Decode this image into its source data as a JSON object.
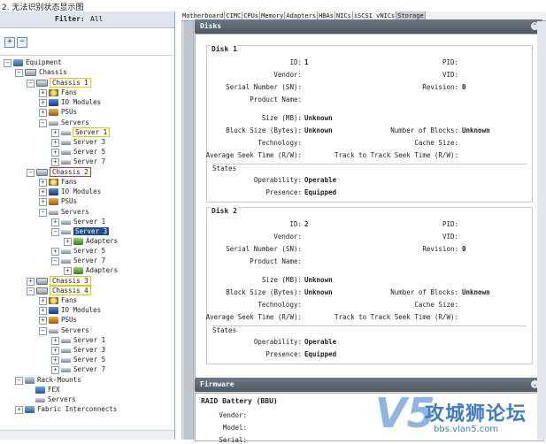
{
  "caption": "2. 无法识别状态显示图",
  "filter": {
    "label": "Filter:",
    "value": "All"
  },
  "toolbar": {
    "expand": "+",
    "collapse": "−"
  },
  "tree": {
    "equipment": "Equipment",
    "chassis": "Chassis",
    "c1": "Chassis 1",
    "fans": "Fans",
    "io": "IO Modules",
    "psus": "PSUs",
    "servers": "Servers",
    "server1": "Server 1",
    "server3": "Server 3",
    "server5": "Server 5",
    "server7": "Server 7",
    "c2": "Chassis 2",
    "adapters": "Adapters",
    "c3": "Chassis 3",
    "c4": "Chassis 4",
    "rack": "Rack-Mounts",
    "fex": "FEX",
    "rservers": "Servers",
    "fi": "Fabric Interconnects"
  },
  "tabs": [
    "Motherboard",
    "CIMC",
    "CPUs",
    "Memory",
    "Adapters",
    "HBAs",
    "NICs",
    "iSCSI vNICs",
    "Storage"
  ],
  "disks_header": "Disks",
  "firmware_header": "Firmware",
  "labels": {
    "id": "ID:",
    "vendor": "Vendor:",
    "serial": "Serial Number (SN):",
    "product": "Product Name:",
    "pid": "PID:",
    "vid": "VID:",
    "revision": "Revision:",
    "size": "Size (MB):",
    "block_size": "Block Size (Bytes):",
    "technology": "Technology:",
    "avg_seek": "Average Seek Time (R/W):",
    "num_blocks": "Number of Blocks:",
    "cache_size": "Cache Size:",
    "t2t_seek": "Track to Track Seek Time (R/W):",
    "states": "States",
    "operability": "Operability:",
    "presence": "Presence:"
  },
  "disk1": {
    "title": "Disk 1",
    "id": "1",
    "revision": "0",
    "size": "Unknown",
    "block_size": "Unknown",
    "num_blocks": "Unknown",
    "operability": "Operable",
    "presence": "Equipped"
  },
  "disk2": {
    "title": "Disk 2",
    "id": "2",
    "revision": "0",
    "size": "Unknown",
    "block_size": "Unknown",
    "num_blocks": "Unknown",
    "operability": "Operable",
    "presence": "Equipped"
  },
  "raid": {
    "title": "RAID Battery (BBU)",
    "vendor": "Vendor:",
    "model": "Model:",
    "serial": "Serial:"
  },
  "watermark": {
    "logo": "V5",
    "text": "攻城狮论坛",
    "url": "bbs.vlan5.com"
  }
}
